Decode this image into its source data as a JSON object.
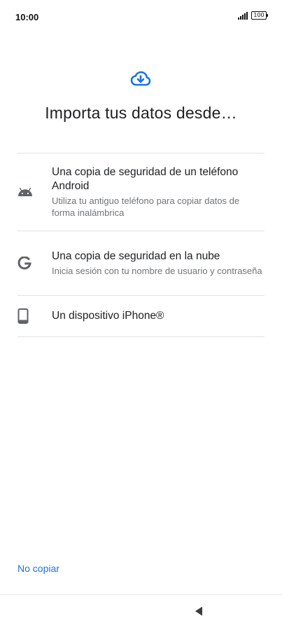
{
  "status_bar": {
    "time": "10:00",
    "battery": "100",
    "icons": [
      "signal-icon",
      "battery-icon"
    ]
  },
  "header": {
    "icon": "cloud-download-icon",
    "title": "Importa tus datos desde…"
  },
  "options": [
    {
      "icon": "android-icon",
      "title": "Una copia de seguridad de un teléfono Android",
      "subtitle": "Utiliza tu antiguo teléfono para copiar datos de forma inalámbrica"
    },
    {
      "icon": "google-icon",
      "title": "Una copia de seguridad en la nube",
      "subtitle": "Inicia sesión con tu nombre de usuario y contraseña"
    },
    {
      "icon": "phone-icon",
      "title": "Un dispositivo iPhone®"
    }
  ],
  "footer": {
    "skip_label": "No copiar"
  },
  "nav_bar": {
    "back_icon": "back-triangle-icon"
  },
  "colors": {
    "accent": "#1a73e8",
    "title_text": "#202124",
    "secondary_text": "#70757a",
    "divider": "#e2e2e2",
    "icon_gray": "#5f6368"
  }
}
